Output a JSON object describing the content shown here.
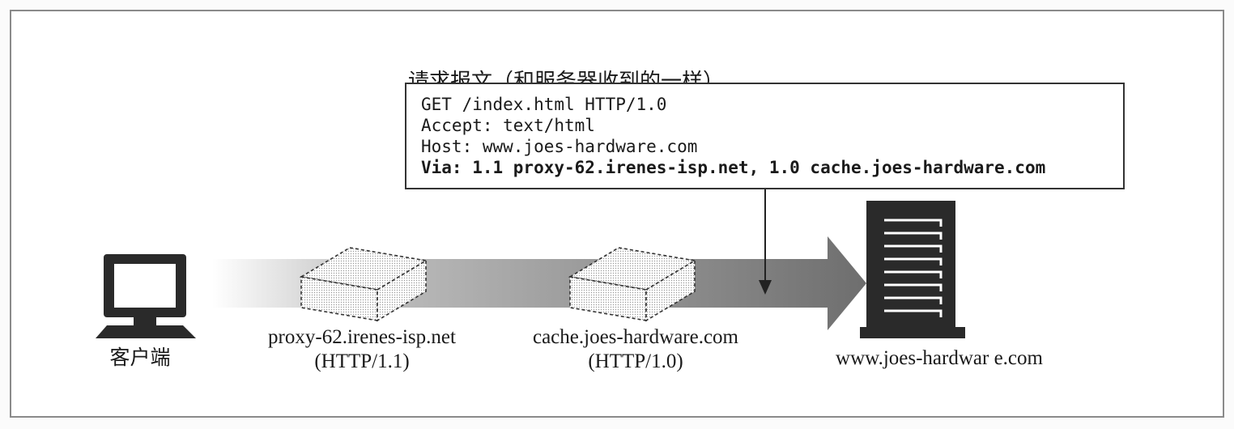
{
  "request_message": {
    "title": "请求报文（和服务器收到的一样）",
    "lines": [
      "GET /index.html HTTP/1.0",
      "Accept: text/html",
      "Host: www.joes-hardware.com",
      "Via: 1.1 proxy-62.irenes-isp.net, 1.0 cache.joes-hardware.com"
    ]
  },
  "nodes": {
    "client": {
      "label": "客户端",
      "icon": "computer-icon"
    },
    "proxy": {
      "name": "proxy-62.irenes-isp.net",
      "protocol": "(HTTP/1.1)",
      "icon": "proxy-box-icon"
    },
    "cache": {
      "name": "cache.joes-hardware.com",
      "protocol": "(HTTP/1.0)",
      "icon": "cache-box-icon"
    },
    "server": {
      "label": "www.joes-hardwar e.com",
      "icon": "server-icon"
    }
  },
  "colors": {
    "flow_arrow": "#7a7a7a",
    "ink": "#1a1a1a"
  }
}
